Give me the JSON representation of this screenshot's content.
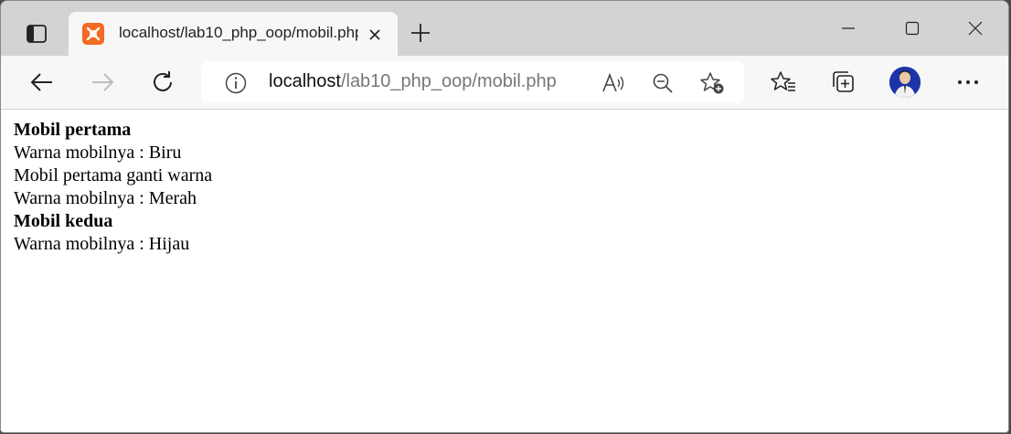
{
  "browser": {
    "tab": {
      "title": "localhost/lab10_php_oop/mobil.php",
      "favicon": "xampp-icon"
    },
    "address": {
      "host": "localhost",
      "path": "/lab10_php_oop/mobil.php"
    },
    "colors": {
      "titlebar": "#d3d3d3",
      "toolbar": "#f7f7f7",
      "favicon": "#f26b21",
      "avatar": "#1c34a8"
    }
  },
  "page": {
    "lines": [
      {
        "text": "Mobil pertama",
        "bold": true
      },
      {
        "text": "Warna mobilnya : Biru",
        "bold": false
      },
      {
        "text": "Mobil pertama ganti warna",
        "bold": false
      },
      {
        "text": "Warna mobilnya : Merah",
        "bold": false
      },
      {
        "text": "Mobil kedua",
        "bold": true
      },
      {
        "text": "Warna mobilnya : Hijau",
        "bold": false
      }
    ]
  }
}
